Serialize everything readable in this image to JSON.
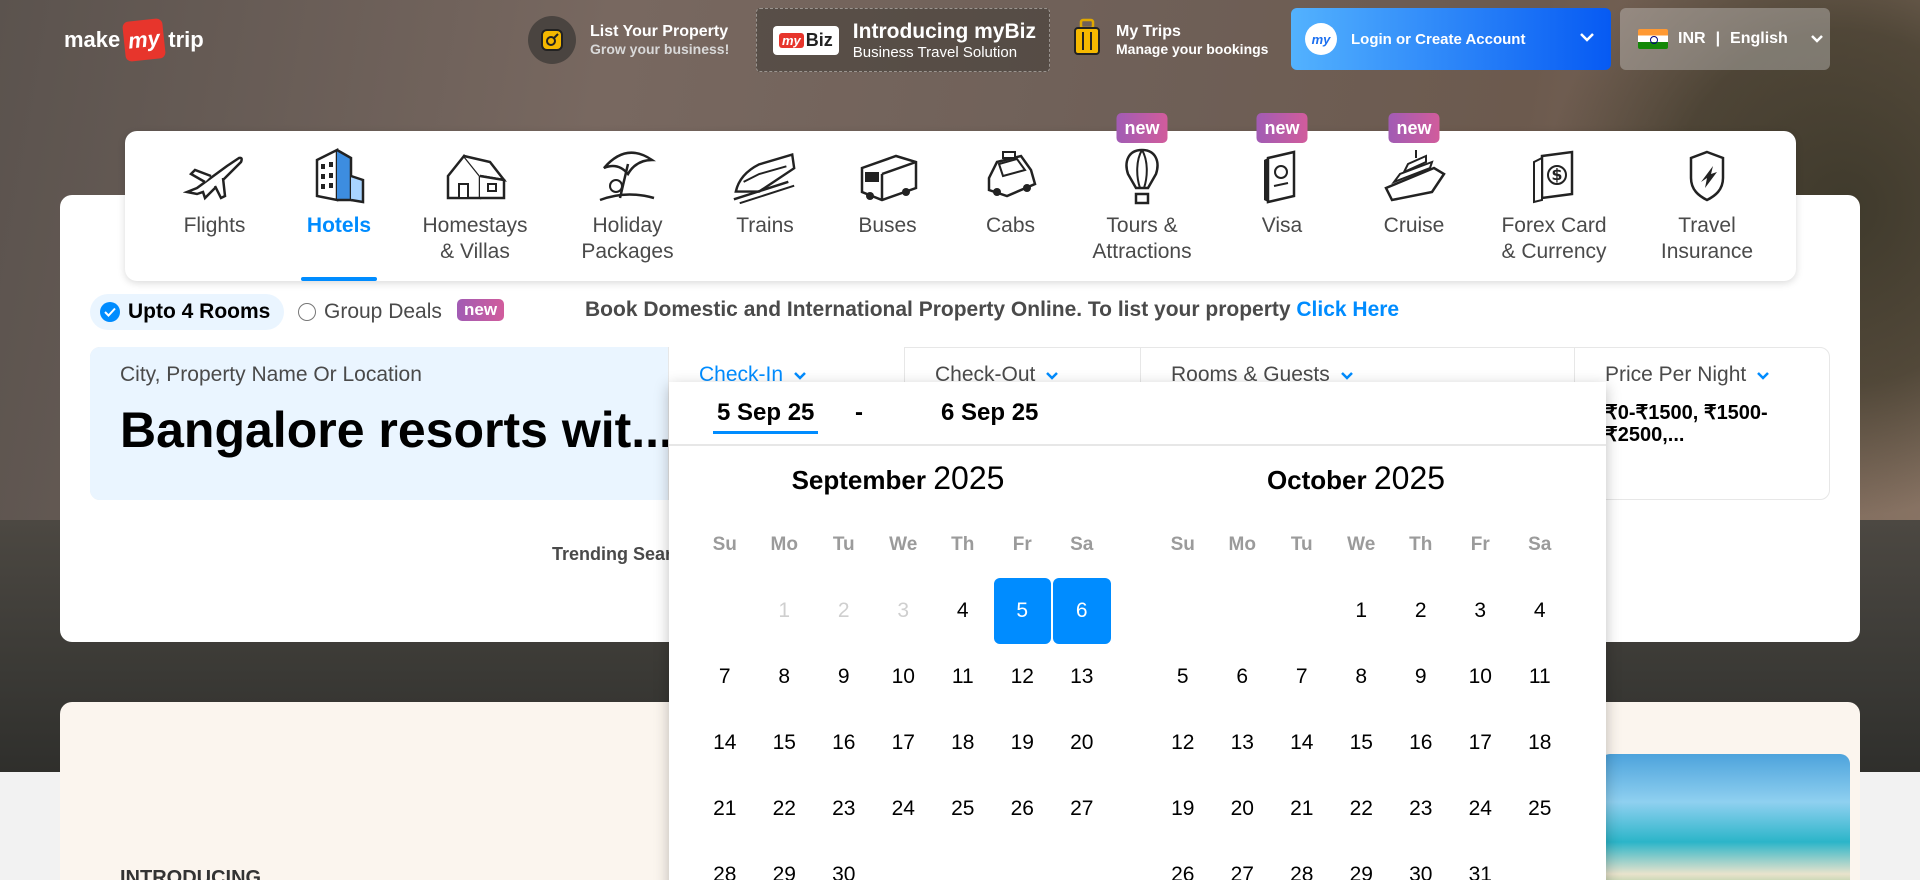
{
  "header": {
    "logo_text_left": "make",
    "logo_text_mid": "my",
    "logo_text_right": "trip",
    "list_property_title": "List Your Property",
    "list_property_sub": "Grow your business!",
    "mybiz_logo": "Biz",
    "mybiz_logo_badge": "my",
    "mybiz_title": "Introducing myBiz",
    "mybiz_sub": "Business Travel Solution",
    "mytrips_title": "My Trips",
    "mytrips_sub": "Manage your bookings",
    "login_label": "Login or Create Account",
    "login_avatar": "my",
    "currency": "INR",
    "separator": "|",
    "language": "English"
  },
  "nav": {
    "items": [
      {
        "label": "Flights",
        "icon": "airplane-icon"
      },
      {
        "label": "Hotels",
        "icon": "hotel-building-icon",
        "active": true
      },
      {
        "label": "Homestays\n& Villas",
        "label1": "Homestays",
        "label2": "& Villas",
        "icon": "house-icon"
      },
      {
        "label1": "Holiday",
        "label2": "Packages",
        "icon": "beach-umbrella-icon"
      },
      {
        "label1": "Trains",
        "icon": "train-icon"
      },
      {
        "label1": "Buses",
        "icon": "bus-icon"
      },
      {
        "label1": "Cabs",
        "icon": "car-icon"
      },
      {
        "label1": "Tours &",
        "label2": "Attractions",
        "icon": "hot-air-balloon-icon",
        "badge": "new"
      },
      {
        "label1": "Visa",
        "icon": "passport-icon",
        "badge": "new"
      },
      {
        "label1": "Cruise",
        "icon": "cruise-ship-icon",
        "badge": "new"
      },
      {
        "label1": "Forex Card",
        "label2": "& Currency",
        "icon": "forex-card-icon"
      },
      {
        "label1": "Travel",
        "label2": "Insurance",
        "icon": "insurance-shield-icon"
      }
    ]
  },
  "options": {
    "rooms_label": "Upto 4 Rooms",
    "group_label": "Group Deals",
    "group_badge": "new",
    "book_text": "Book Domestic and International Property Online. To list your property",
    "book_link": "Click Here"
  },
  "search": {
    "city_label": "City, Property Name Or Location",
    "city_value": "Bangalore resorts wit...",
    "checkin_label": "Check-In",
    "checkout_label": "Check-Out",
    "rooms_label": "Rooms & Guests",
    "price_label": "Price Per Night",
    "price_value": "₹0-₹1500, ₹1500-₹2500,...",
    "trending": "Trending Searc"
  },
  "lower": {
    "intro": "INTRODUCING"
  },
  "calendar": {
    "checkin": "5 Sep 25",
    "separator": "-",
    "checkout": "6 Sep 25",
    "weekdays": [
      "Su",
      "Mo",
      "Tu",
      "We",
      "Th",
      "Fr",
      "Sa"
    ],
    "months": [
      {
        "name": "September",
        "year": "2025",
        "offset": 1,
        "days": [
          "1",
          "2",
          "3",
          "4",
          "5",
          "6",
          "7",
          "8",
          "9",
          "10",
          "11",
          "12",
          "13",
          "14",
          "15",
          "16",
          "17",
          "18",
          "19",
          "20",
          "21",
          "22",
          "23",
          "24",
          "25",
          "26",
          "27",
          "28",
          "29",
          "30"
        ],
        "disabled": [
          "1",
          "2",
          "3"
        ],
        "selected": [
          "5",
          "6"
        ]
      },
      {
        "name": "October",
        "year": "2025",
        "offset": 3,
        "days": [
          "1",
          "2",
          "3",
          "4",
          "5",
          "6",
          "7",
          "8",
          "9",
          "10",
          "11",
          "12",
          "13",
          "14",
          "15",
          "16",
          "17",
          "18",
          "19",
          "20",
          "21",
          "22",
          "23",
          "24",
          "25",
          "26",
          "27",
          "28",
          "29",
          "30",
          "31"
        ],
        "disabled": [],
        "selected": []
      }
    ]
  },
  "colors": {
    "accent": "#008cff",
    "brand_red": "#e7352c",
    "badge": "#a15cb4"
  }
}
